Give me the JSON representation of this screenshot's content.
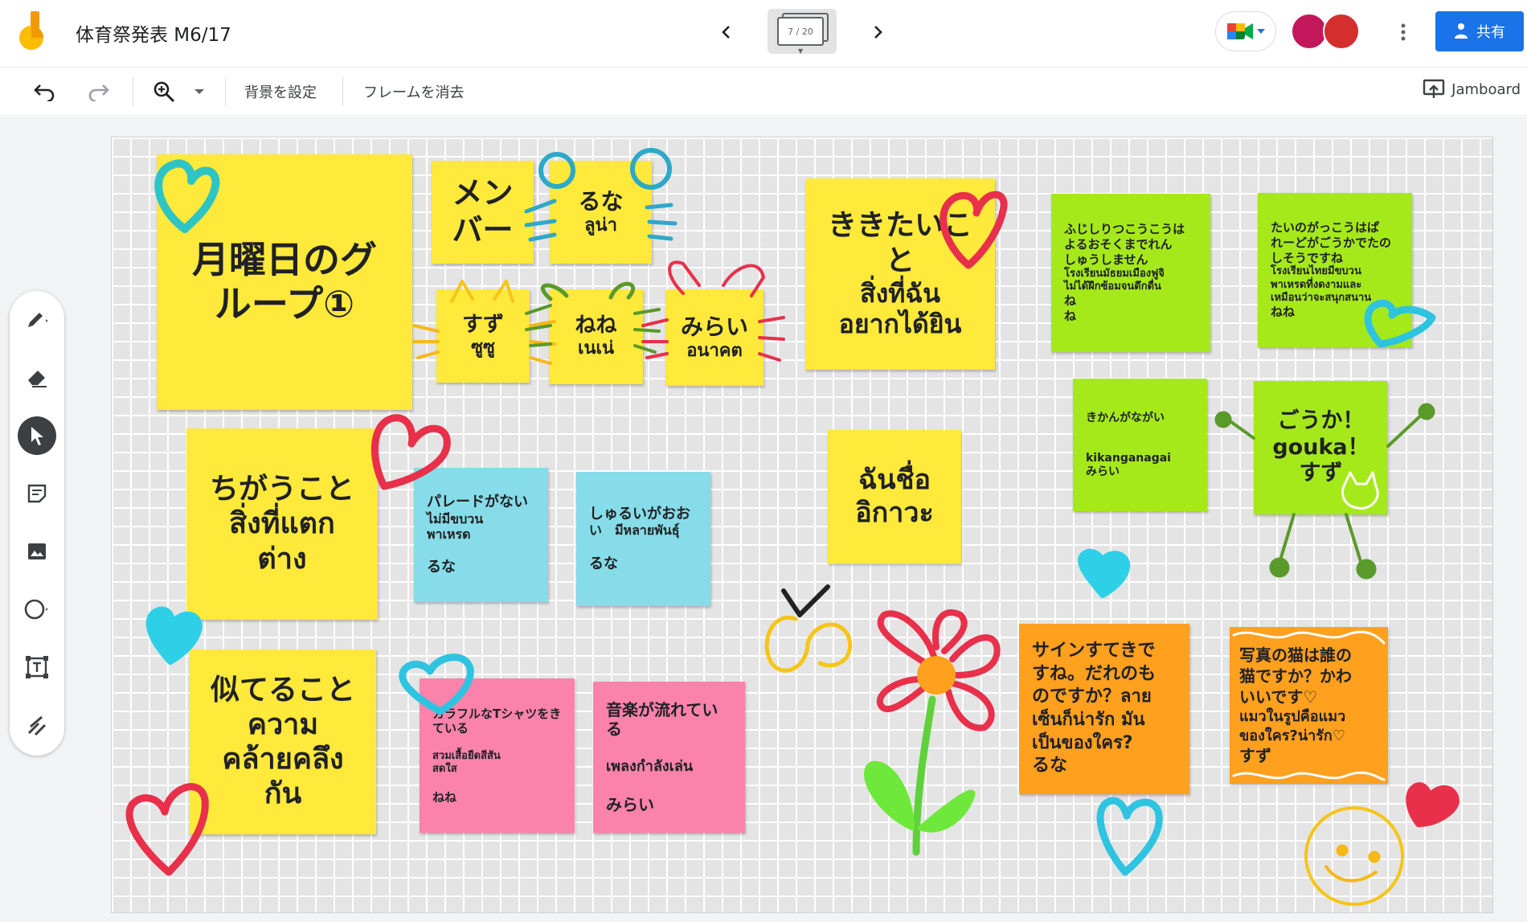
{
  "app": {
    "document_title": "体育祭発表 M6/17",
    "frame_indicator": "7 / 20",
    "share_label": "共有",
    "jamboard_label": "Jamboard"
  },
  "toolbar": {
    "set_background_label": "背景を設定",
    "clear_frame_label": "フレームを消去"
  },
  "notes": {
    "title": [
      "月曜日のグ",
      "ループ①"
    ],
    "members_header": [
      "メン",
      "バー"
    ],
    "runa": [
      "るな",
      "ลูน่า"
    ],
    "suzu": [
      "すず",
      "ซูซู"
    ],
    "nene": [
      "ねね",
      "เนเน่"
    ],
    "mirai": [
      "みらい",
      "อนาคต"
    ],
    "want_to_hear": [
      "ききたいこ",
      "と",
      "สิ่งที่ฉัน",
      "อยากได้ยิน"
    ],
    "differences": [
      "ちがうこと",
      "สิ่งที่แตก",
      "ต่าง"
    ],
    "similarities": [
      "似てること",
      "ความ",
      "คล้ายคลึง",
      "กัน"
    ],
    "my_name": [
      "ฉันชื่อ",
      "อิกาวะ"
    ],
    "parade": [
      "パレードがない",
      "ไม่มีขบวน",
      "พาเหรด",
      "",
      "るな"
    ],
    "many_kinds": [
      "しゅるいがおお",
      "い　มีหลายพันธุ์",
      "",
      "るな"
    ],
    "colorful_tshirt": [
      "カラフルなTシャツをき",
      "ている",
      "",
      "สวมเสื้อยืดสีสัน",
      "สดใส",
      "",
      "ねね"
    ],
    "music": [
      "音楽が流れてい",
      "る",
      "",
      "เพลงกำลังเล่น",
      "",
      "みらい"
    ],
    "fujishiro": [
      "ふじしりつこうこうは",
      "よるおそくまでれん",
      "しゅうしません",
      "โรงเรียนมัธยมเมืองฟูจิ",
      "ไม่ได้ฝึกซ้อมจนดึกดื่น",
      "ね",
      "ね"
    ],
    "thai_school": [
      "たいのがっこうはぱ",
      "れーどがごうかでたの",
      "しそうですね",
      "โรงเรียนไทยมีขบวน",
      "พาเหรดที่งดงามและ",
      "เหมือนว่าจะสนุกสนาน",
      "ねね"
    ],
    "kikan": [
      "きかんがながい",
      "",
      "",
      "kikanganagai",
      "みらい"
    ],
    "gouka": [
      "ごうか！",
      "gouka！",
      "すず"
    ],
    "sign": [
      "サインすてきで",
      "すね。だれのも",
      "のですか？ลาย",
      "เซ็นก็น่ารัก มัน",
      "เป็นของใคร?",
      "るな"
    ],
    "cat_photo": [
      "写真の猫は誰の",
      "猫ですか？かわ",
      "いいです♡",
      "แมวในรูปคือแมว",
      "ของใคร?น่ารัก♡",
      "すず"
    ]
  },
  "colors": {
    "yellow_note": "#ffe93b",
    "green_note": "#a5e91b",
    "blue_note": "#86dce8",
    "pink_note": "#fb83ab",
    "orange_note": "#ffa01e",
    "share_button": "#1a73e8",
    "board_grid": "#e4e4e4"
  },
  "icons": {
    "undo": "undo-icon",
    "redo": "redo-icon",
    "zoom": "zoom-in-icon",
    "pen": "pen-icon",
    "eraser": "eraser-icon",
    "select": "select-arrow-icon",
    "sticky": "sticky-note-icon",
    "image": "image-icon",
    "shape": "circle-icon",
    "textbox": "textbox-icon",
    "laser": "laser-icon"
  }
}
